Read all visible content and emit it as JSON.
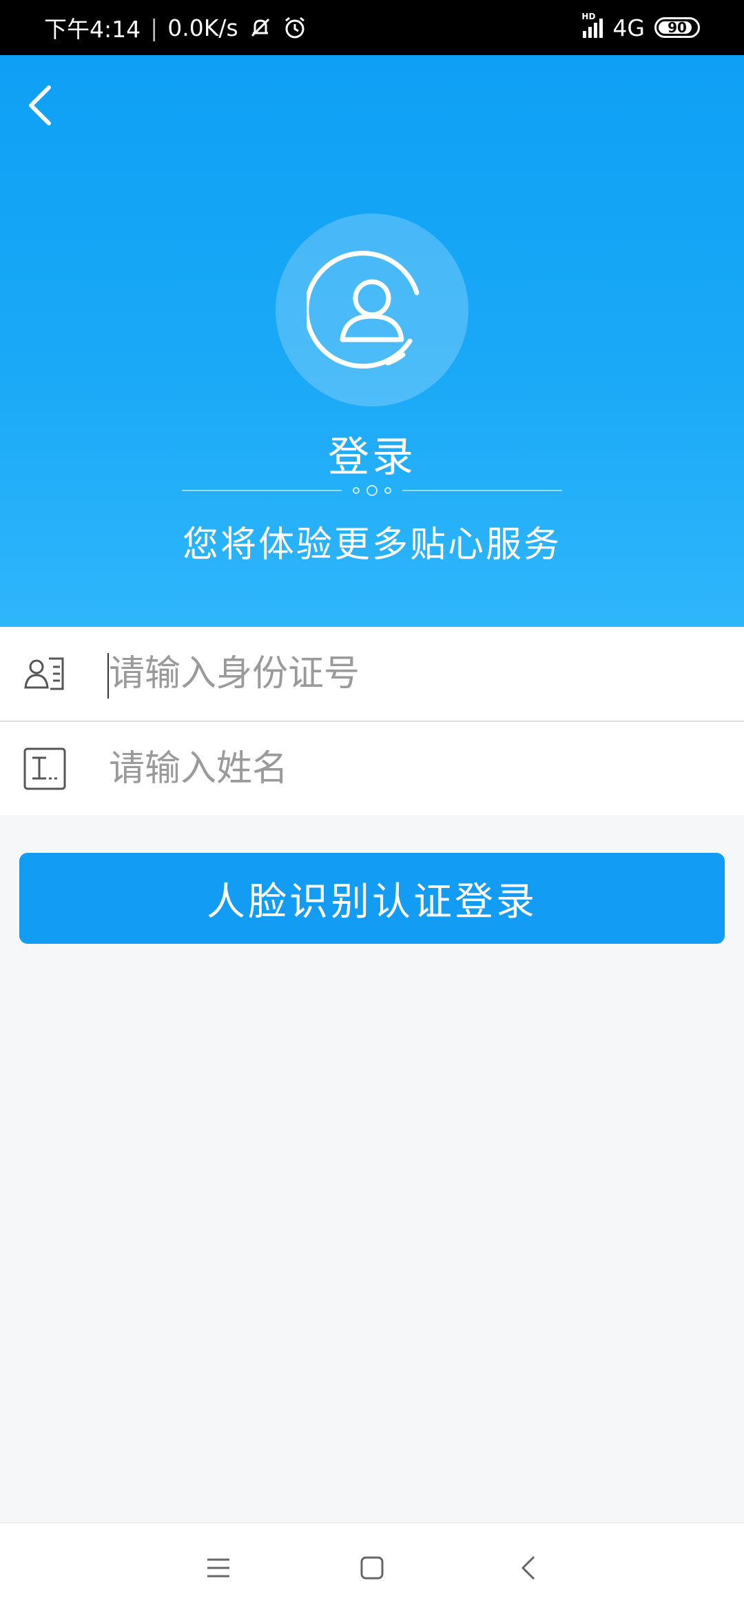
{
  "status_bar": {
    "time": "下午4:14",
    "separator": "|",
    "net_speed": "0.0K/s",
    "network": "4G",
    "battery": "90",
    "battery_level": 0.9
  },
  "header": {
    "title": "登录",
    "subtitle": "您将体验更多贴心服务"
  },
  "form": {
    "id_number_placeholder": "请输入身份证号",
    "name_placeholder": "请输入姓名"
  },
  "actions": {
    "face_login_label": "人脸识别认证登录"
  },
  "colors": {
    "primary": "#139cf3",
    "header_top": "#0ea0f5",
    "header_bottom": "#2fb6fb",
    "background": "#f6f7f9"
  },
  "icons": [
    "back-arrow-icon",
    "user-avatar-icon",
    "id-card-icon",
    "name-card-icon",
    "muted-bell-icon",
    "alarm-icon",
    "signal-icon",
    "battery-icon",
    "menu-icon",
    "home-icon",
    "back-icon"
  ]
}
